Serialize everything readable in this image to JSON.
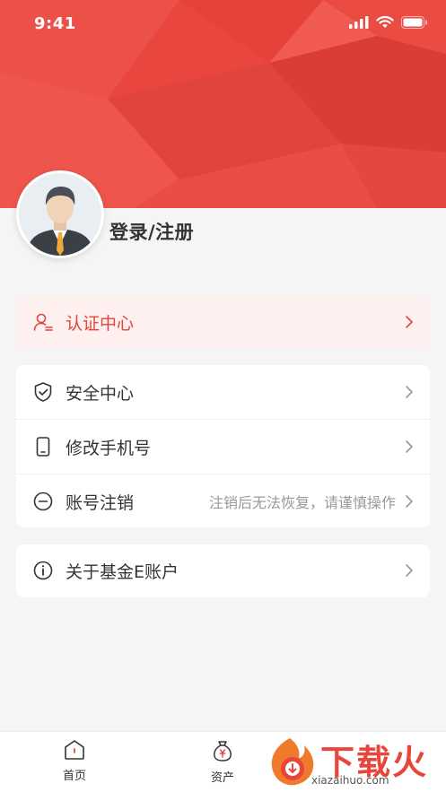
{
  "status_bar": {
    "time": "9:41"
  },
  "profile": {
    "login_label": "登录/注册"
  },
  "menu": {
    "certification": {
      "label": "认证中心",
      "icon": "user-cert-icon"
    },
    "security": {
      "label": "安全中心",
      "icon": "shield-check-icon"
    },
    "change_phone": {
      "label": "修改手机号",
      "icon": "phone-icon"
    },
    "cancel_account": {
      "label": "账号注销",
      "hint": "注销后无法恢复，请谨慎操作",
      "icon": "minus-circle-icon"
    },
    "about": {
      "label": "关于基金E账户",
      "icon": "info-circle-icon"
    }
  },
  "tabbar": {
    "home": "首页",
    "assets": "资产"
  },
  "watermark": {
    "text": "下载火",
    "url": "xiazaihuo.com"
  },
  "colors": {
    "brand_red": "#e8463f",
    "text_primary": "#333333",
    "text_hint": "#999999",
    "cert_bg": "#fdf0ef"
  }
}
